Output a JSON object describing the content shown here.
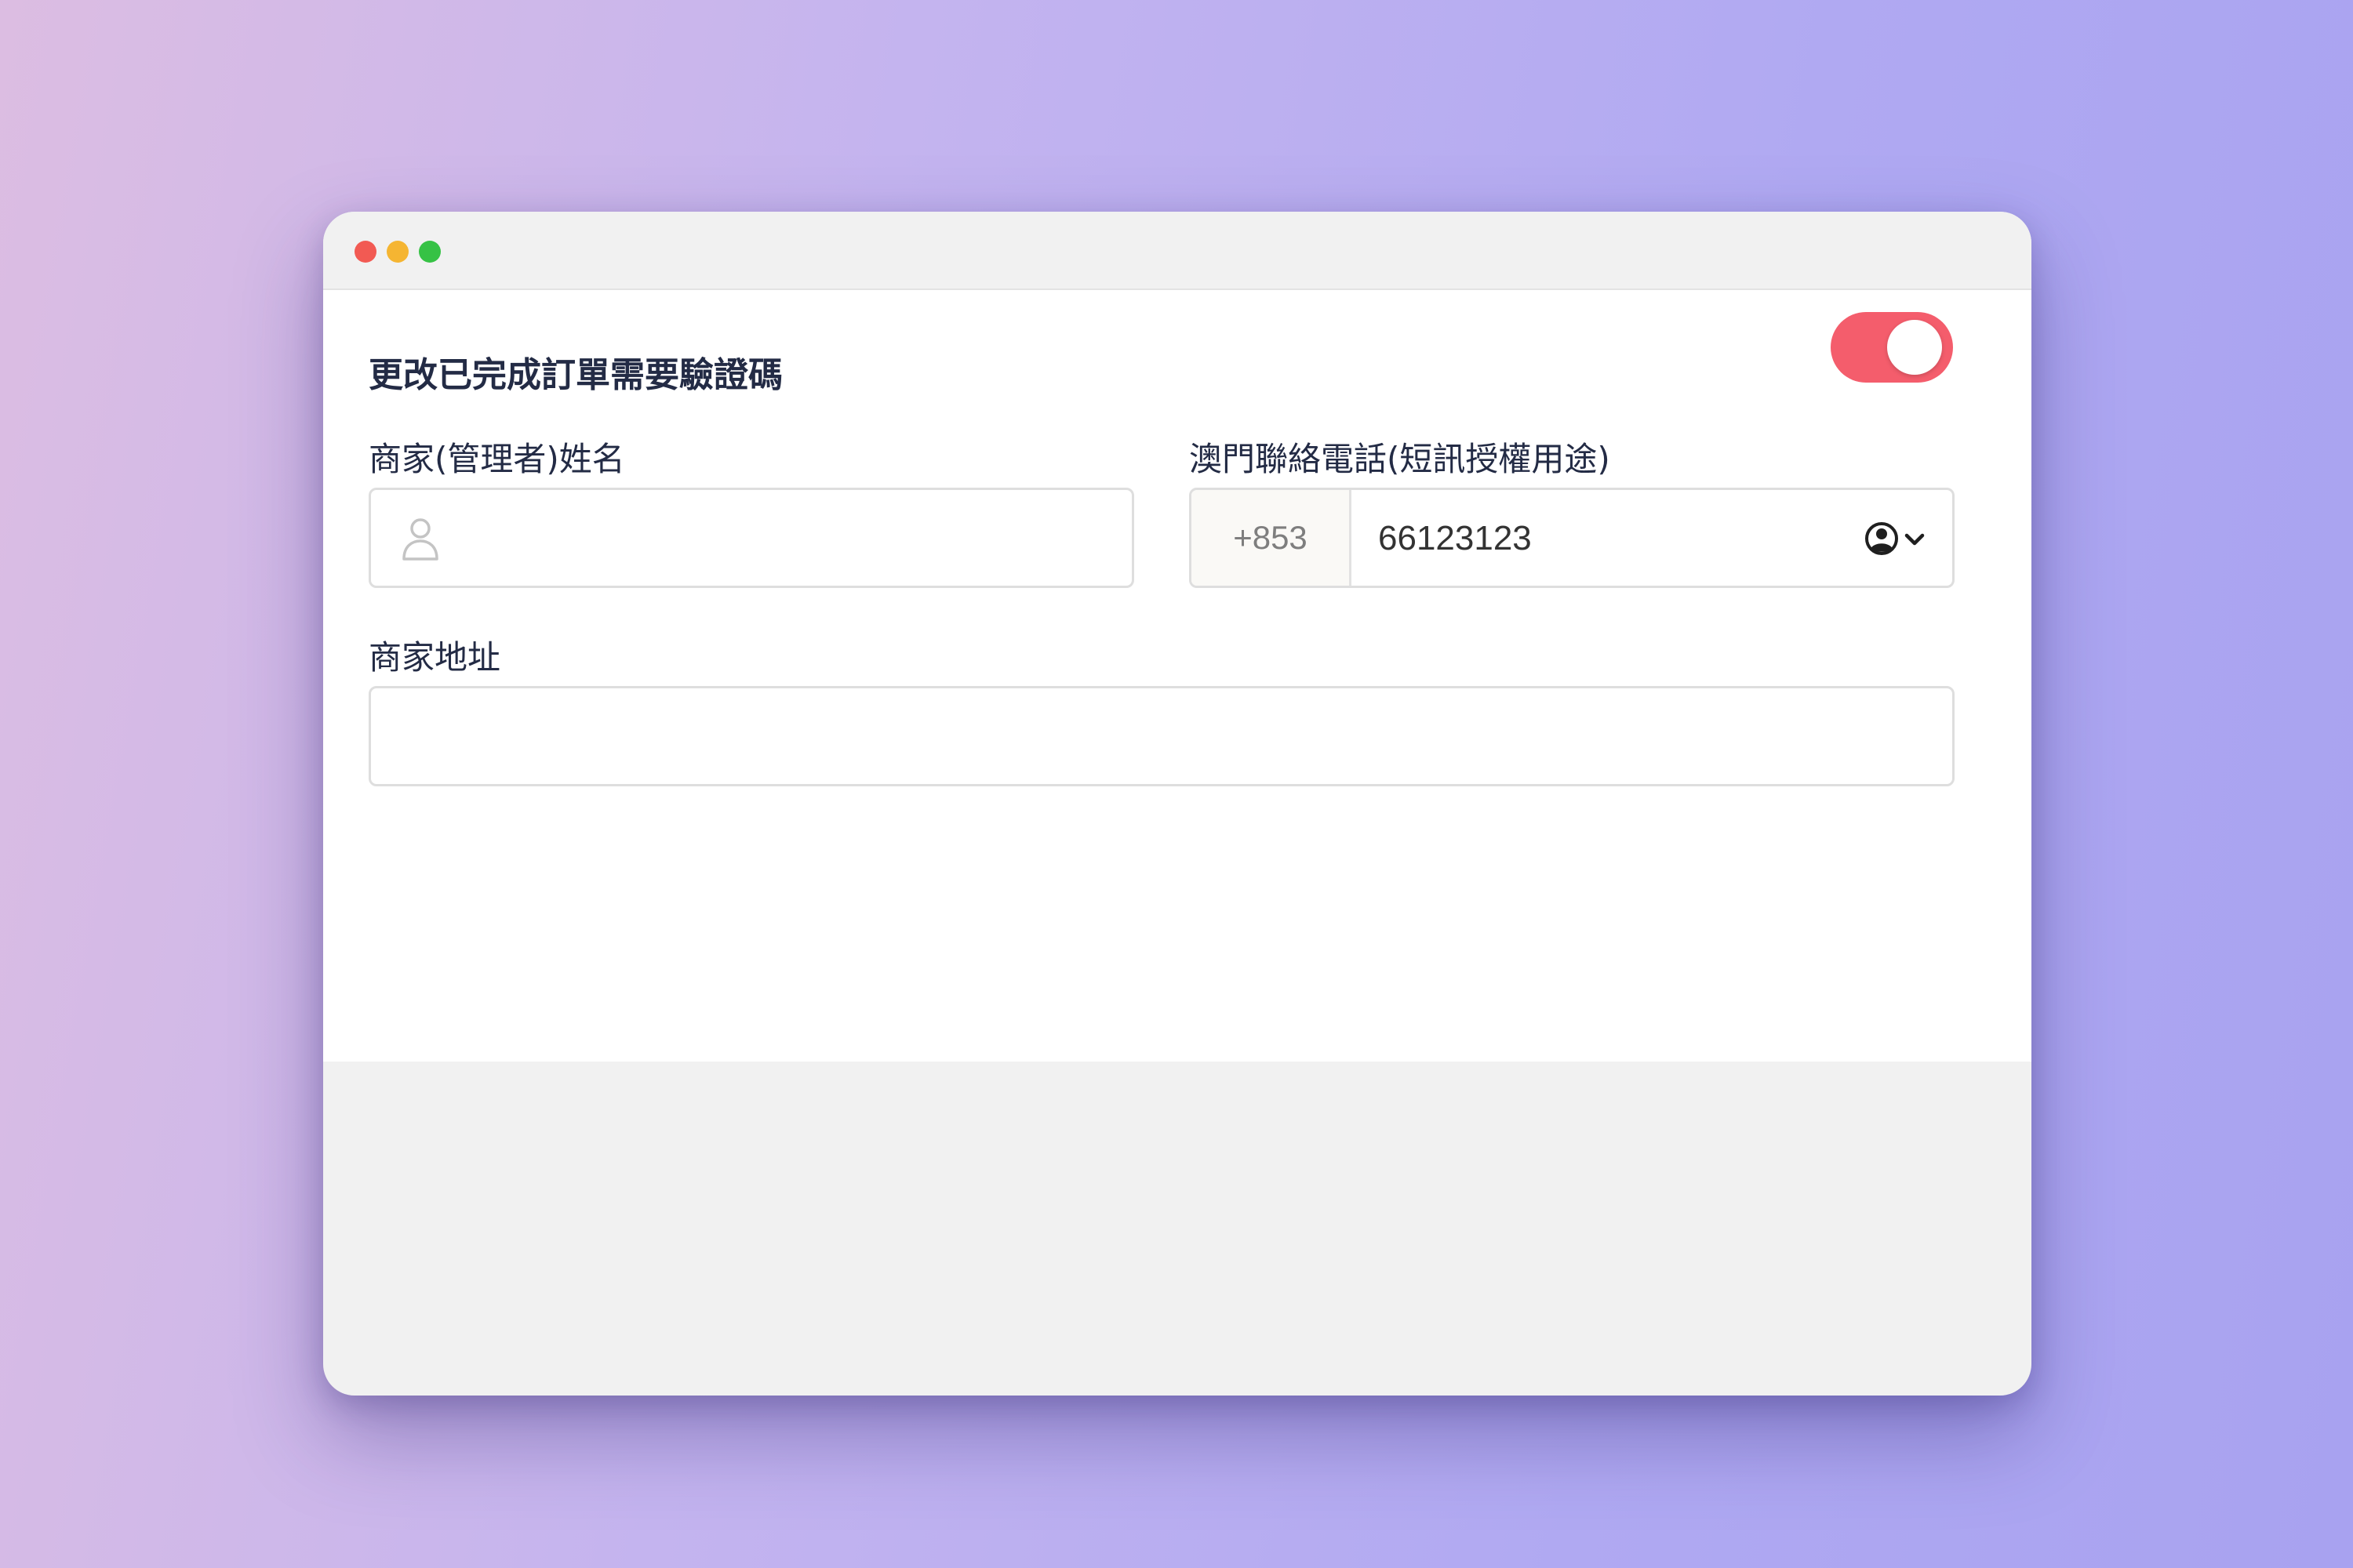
{
  "settings": {
    "verification_toggle_label": "更改已完成訂單需要驗證碼",
    "verification_toggle_on": true,
    "toggle_color": "#f45d6c"
  },
  "form": {
    "merchant_name": {
      "label": "商家(管理者)姓名",
      "value": "",
      "icon": "person-icon"
    },
    "phone": {
      "label": "澳門聯絡電話(短訊授權用途)",
      "country_code": "+853",
      "value": "66123123",
      "picker_icon": "contact-picker-icon"
    },
    "address": {
      "label": "商家地址",
      "value": ""
    }
  }
}
